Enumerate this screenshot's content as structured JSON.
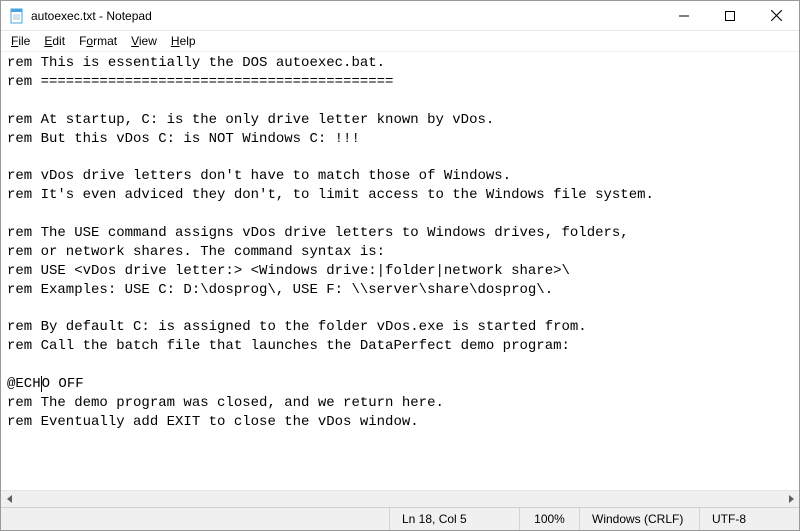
{
  "window": {
    "title": "autoexec.txt - Notepad"
  },
  "menu": {
    "file": "File",
    "edit": "Edit",
    "format": "Format",
    "view": "View",
    "help": "Help"
  },
  "content": {
    "lines": [
      "rem This is essentially the DOS autoexec.bat.",
      "rem ==========================================",
      "",
      "rem At startup, C: is the only drive letter known by vDos.",
      "rem But this vDos C: is NOT Windows C: !!!",
      "",
      "rem vDos drive letters don't have to match those of Windows.",
      "rem It's even adviced they don't, to limit access to the Windows file system.",
      "",
      "rem The USE command assigns vDos drive letters to Windows drives, folders,",
      "rem or network shares. The command syntax is:",
      "rem USE <vDos drive letter:> <Windows drive:|folder|network share>\\",
      "rem Examples: USE C: D:\\dosprog\\, USE F: \\\\server\\share\\dosprog\\.",
      "",
      "rem By default C: is assigned to the folder vDos.exe is started from.",
      "rem Call the batch file that launches the DataPerfect demo program:",
      "",
      "@ECHO OFF",
      "rem The demo program was closed, and we return here.",
      "rem Eventually add EXIT to close the vDos window."
    ],
    "caret_line_index": 17,
    "caret_col": 4
  },
  "status": {
    "position": "Ln 18, Col 5",
    "zoom": "100%",
    "eol": "Windows (CRLF)",
    "encoding": "UTF-8"
  }
}
